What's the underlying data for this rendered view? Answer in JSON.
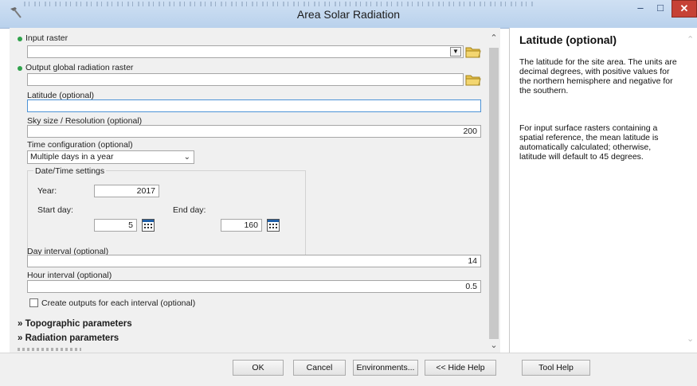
{
  "window": {
    "title": "Area Solar Radiation"
  },
  "form": {
    "input_raster": {
      "label": "Input raster",
      "value": ""
    },
    "output_raster": {
      "label": "Output global radiation raster",
      "value": ""
    },
    "latitude": {
      "label": "Latitude (optional)",
      "value": ""
    },
    "sky_size": {
      "label": "Sky size / Resolution (optional)",
      "value": "200"
    },
    "time_config": {
      "label": "Time configuration (optional)",
      "selected": "Multiple days in a year"
    },
    "datetime": {
      "group_label": "Date/Time settings",
      "year_label": "Year:",
      "year": "2017",
      "start_label": "Start day:",
      "start": "5",
      "end_label": "End day:",
      "end": "160"
    },
    "day_interval": {
      "label": "Day interval (optional)",
      "value": "14"
    },
    "hour_interval": {
      "label": "Hour interval (optional)",
      "value": "0.5"
    },
    "create_outputs": {
      "label": "Create outputs for each interval (optional)",
      "checked": false
    },
    "sections": {
      "topographic": "Topographic parameters",
      "radiation": "Radiation parameters"
    }
  },
  "help": {
    "title": "Latitude (optional)",
    "paragraphs": [
      "The latitude for the site area. The units are decimal degrees, with positive values for the northern hemisphere and negative for the southern.",
      "For input surface rasters containing a spatial reference, the mean latitude is automatically calculated; otherwise, latitude will default to 45 degrees."
    ]
  },
  "buttons": {
    "ok": "OK",
    "cancel": "Cancel",
    "environments": "Environments...",
    "hide_help": "<< Hide Help",
    "tool_help": "Tool Help"
  },
  "colors": {
    "required_dot": "#2fa24b",
    "close_button": "#c64236",
    "titlebar": "#c4d9f0"
  },
  "icons": [
    "hammer-icon",
    "minimize-icon",
    "maximize-icon",
    "close-icon",
    "folder-icon",
    "calendar-icon",
    "chevron-down-icon",
    "scroll-up-icon",
    "scroll-down-icon"
  ]
}
